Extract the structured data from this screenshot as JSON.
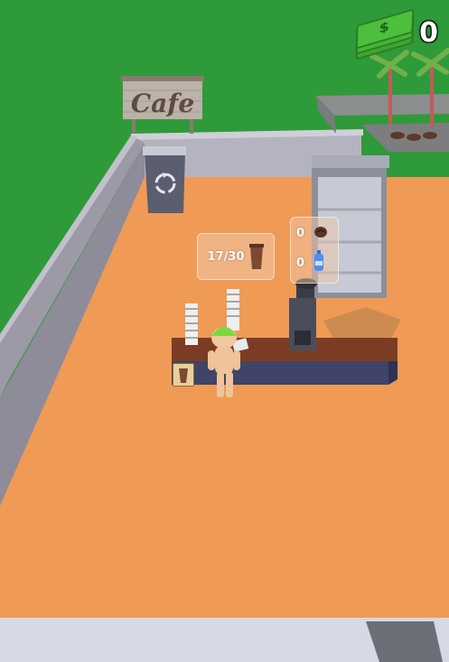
{
  "hud": {
    "money": "0",
    "money_icon": "cash-stack-icon",
    "money_symbol": "$"
  },
  "sign": {
    "text": "Cafe"
  },
  "coffee_counter": {
    "stock": "17/30",
    "icon": "coffee-cup-icon"
  },
  "machine_inventory": {
    "beans": "0",
    "water": "0",
    "bean_icon": "coffee-bean-icon",
    "water_icon": "water-bottle-icon"
  },
  "colors": {
    "grass": "#2f9a3a",
    "floor": "#ef9a55",
    "wall": "#9c9aa6",
    "counter_top": "#7a3d24",
    "counter_front": "#3f4468",
    "road": "#d6d8e3",
    "money_green": "#4cbf3c"
  }
}
